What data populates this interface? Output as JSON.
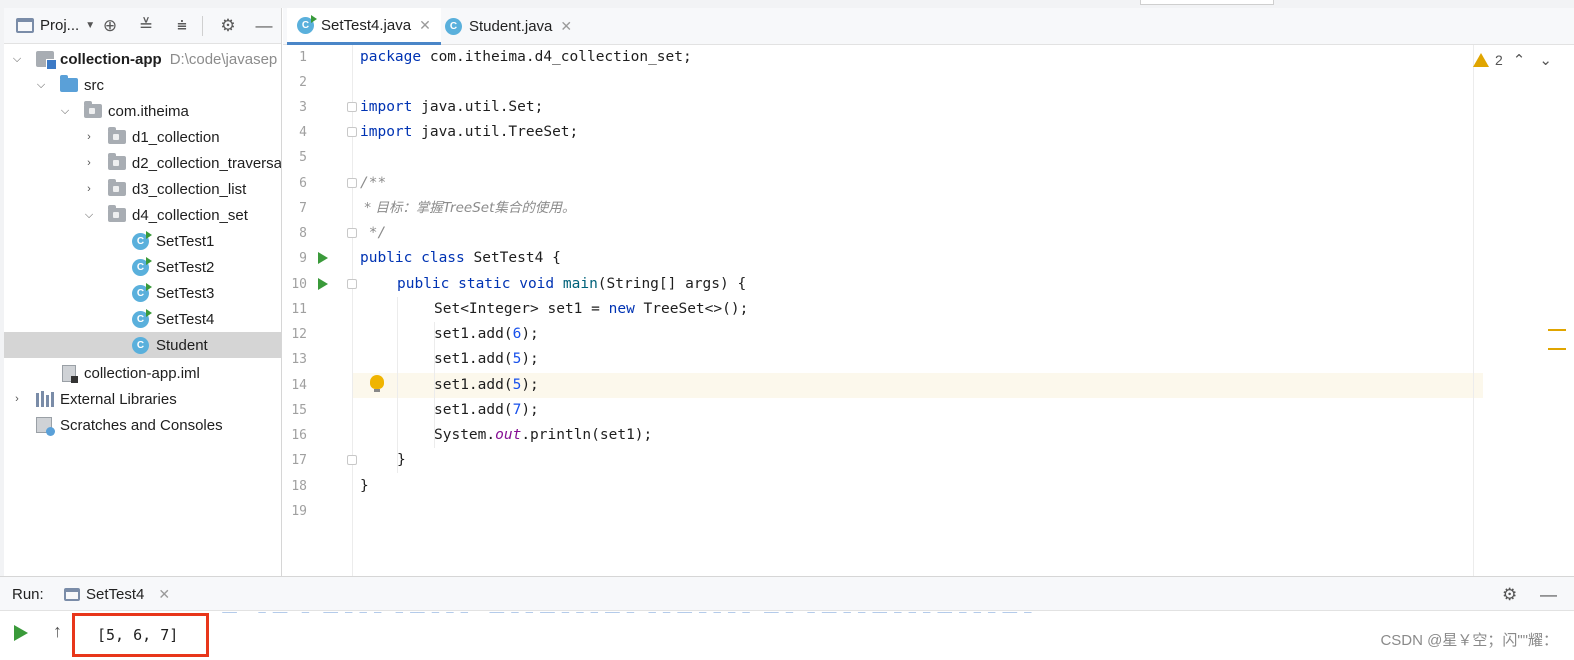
{
  "project_panel": {
    "title": "Proj...",
    "tree": [
      {
        "label": "collection-app",
        "path": "D:\\code\\javasep",
        "type": "module",
        "expanded": true,
        "bold": true
      },
      {
        "label": "src",
        "type": "source-folder",
        "expanded": true
      },
      {
        "label": "com.itheima",
        "type": "package",
        "expanded": true
      },
      {
        "label": "d1_collection",
        "type": "package",
        "expanded": false
      },
      {
        "label": "d2_collection_traversa",
        "type": "package",
        "expanded": false
      },
      {
        "label": "d3_collection_list",
        "type": "package",
        "expanded": false
      },
      {
        "label": "d4_collection_set",
        "type": "package",
        "expanded": true
      },
      {
        "label": "SetTest1",
        "type": "runnable-class"
      },
      {
        "label": "SetTest2",
        "type": "runnable-class"
      },
      {
        "label": "SetTest3",
        "type": "runnable-class"
      },
      {
        "label": "SetTest4",
        "type": "runnable-class"
      },
      {
        "label": "Student",
        "type": "class",
        "selected": true
      },
      {
        "label": "collection-app.iml",
        "type": "iml-file"
      },
      {
        "label": "External Libraries",
        "type": "libraries",
        "expanded": false
      },
      {
        "label": "Scratches and Consoles",
        "type": "scratches"
      }
    ]
  },
  "editor_tabs": [
    {
      "label": "SetTest4.java",
      "active": true
    },
    {
      "label": "Student.java",
      "active": false
    }
  ],
  "editor": {
    "line_numbers": [
      "1",
      "2",
      "3",
      "4",
      "5",
      "6",
      "7",
      "8",
      "9",
      "10",
      "11",
      "12",
      "13",
      "14",
      "15",
      "16",
      "17",
      "18",
      "19"
    ],
    "warnings_count": "2",
    "lines": {
      "l1_kw": "package",
      "l1_rest": " com.itheima.d4_collection_set;",
      "l3_kw": "import",
      "l3_rest": " java.util.Set;",
      "l4_kw": "import",
      "l4_rest": " java.util.TreeSet;",
      "l6": "/**",
      "l7": " * 目标：掌握TreeSet集合的使用。",
      "l8": " */",
      "l9_kw": "public class",
      "l9_rest": " SetTest4 {",
      "l10_kw": "public static void",
      "l10_fn": "main",
      "l10_rest": "(String[] args) {",
      "l11_a": "Set<Integer> set1 = ",
      "l11_kw": "new",
      "l11_b": " TreeSet<>();",
      "l12_a": "set1.add(",
      "l12_n": "6",
      "l12_b": ");",
      "l13_a": "set1.add(",
      "l13_n": "5",
      "l13_b": ");",
      "l14_a": "set1.add(",
      "l14_n": "5",
      "l14_b": ");",
      "l15_a": "set1.add(",
      "l15_n": "7",
      "l15_b": ");",
      "l16_a": "System.",
      "l16_f": "out",
      "l16_b": ".println(set1);",
      "l17": "}",
      "l18": "}"
    }
  },
  "run_panel": {
    "label": "Run:",
    "tab": "SetTest4",
    "output": "[5, 6, 7]",
    "watermark": "CSDN @星￥空；闪\"\"耀："
  },
  "colors": {
    "keyword": "#0033b3",
    "number": "#1750eb",
    "comment": "#8c8c8c",
    "static_field": "#871094",
    "run_green": "#3a9a3a",
    "highlight_box": "#e8361a",
    "tab_underline": "#4a86c8"
  },
  "icons": [
    "window-icon",
    "crosshair-icon",
    "expand-all-icon",
    "collapse-all-icon",
    "gear-icon",
    "minimize-icon",
    "chevron-down-icon",
    "chevron-right-icon",
    "folder-icon",
    "class-icon",
    "warning-icon",
    "run-icon",
    "rerun-up-icon"
  ]
}
